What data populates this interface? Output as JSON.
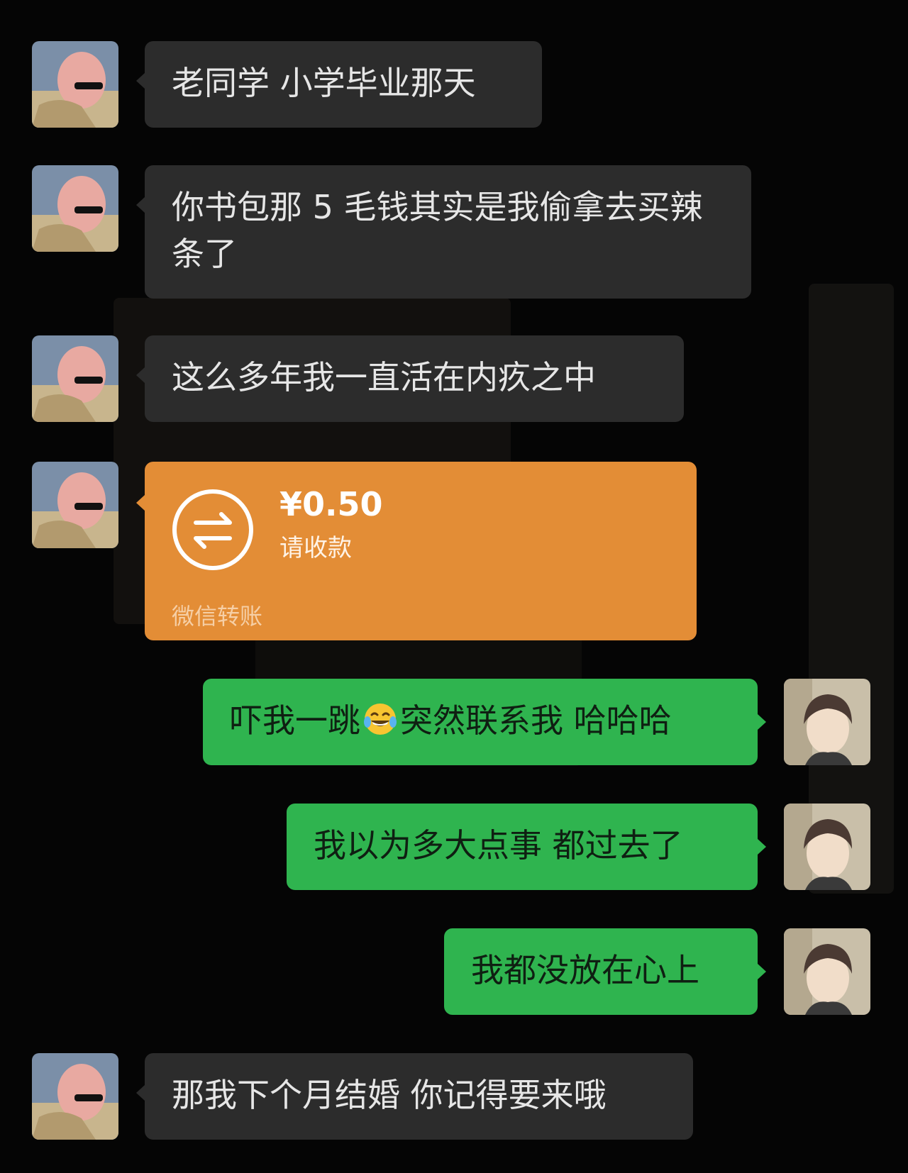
{
  "conversation": {
    "messages": [
      {
        "sender": "friend",
        "type": "text",
        "text": "老同学 小学毕业那天"
      },
      {
        "sender": "friend",
        "type": "text",
        "text": "你书包那 5 毛钱其实是我偷拿去买辣条了"
      },
      {
        "sender": "friend",
        "type": "text",
        "text": "这么多年我一直活在内疚之中"
      },
      {
        "sender": "friend",
        "type": "transfer",
        "amount": "¥0.50",
        "status": "请收款",
        "source": "微信转账"
      },
      {
        "sender": "me",
        "type": "text",
        "text_before": "吓我一跳",
        "emoji": "tears-of-joy-emoji",
        "text_after": "突然联系我 哈哈哈"
      },
      {
        "sender": "me",
        "type": "text",
        "text": "我以为多大点事 都过去了"
      },
      {
        "sender": "me",
        "type": "text",
        "text": "我都没放在心上"
      },
      {
        "sender": "friend",
        "type": "text",
        "text": "那我下个月结婚 你记得要来哦"
      }
    ]
  },
  "avatars": {
    "friend": "bald-man-sunglasses-avatar",
    "me": "anime-boy-avatar"
  },
  "colors": {
    "background": "#050505",
    "incoming_bubble": "#2c2c2c",
    "outgoing_bubble": "#2fb44f",
    "transfer_card": "#e38d36"
  }
}
